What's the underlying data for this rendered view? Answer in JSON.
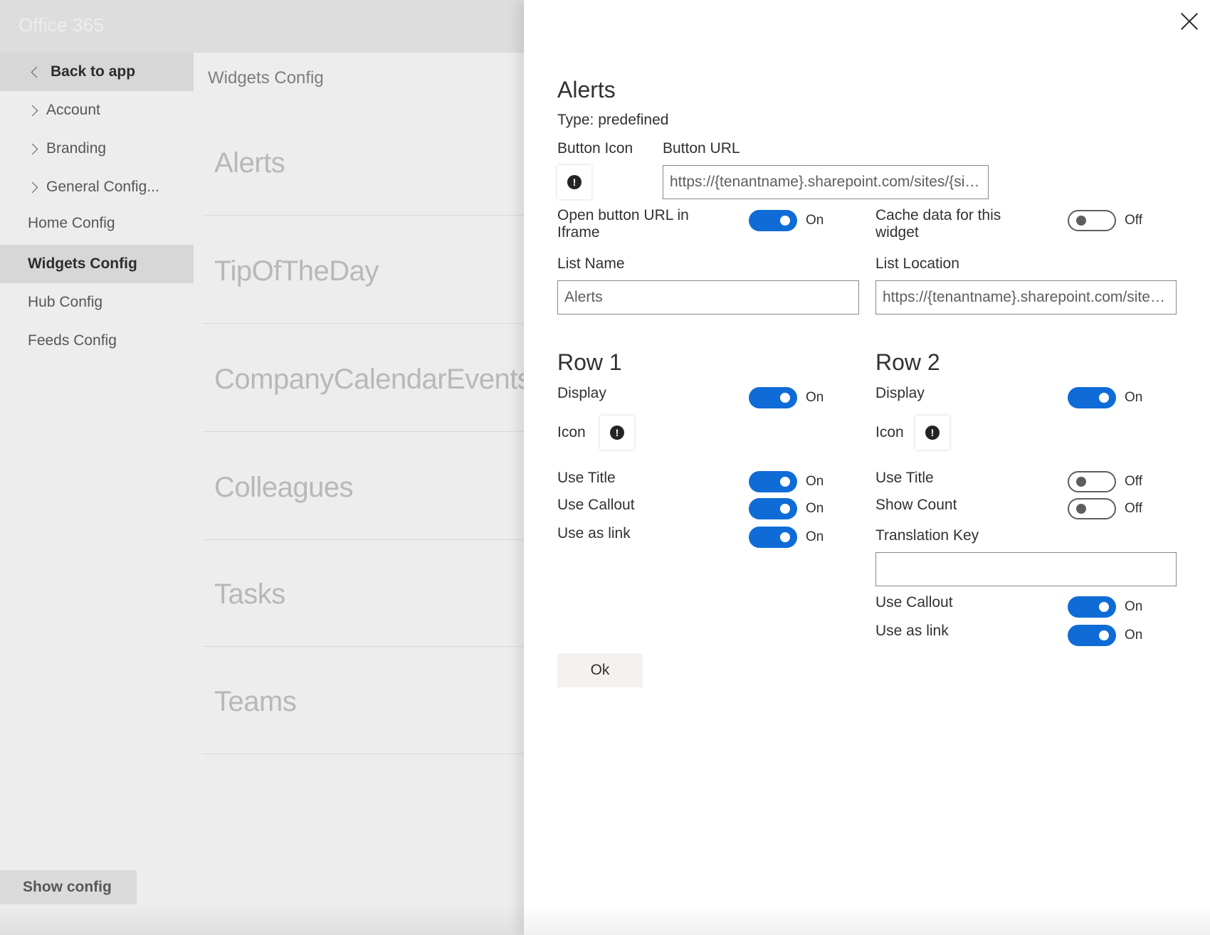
{
  "app": {
    "brand": "Office 365"
  },
  "nav": {
    "back_label": "Back to app",
    "items": [
      "Account",
      "Branding",
      "General Config...",
      "Home Config",
      "Widgets Config",
      "Hub Config",
      "Feeds Config"
    ],
    "selected": "Widgets Config",
    "show_config": "Show config"
  },
  "list": {
    "header": "Widgets Config",
    "widgets": [
      "Alerts",
      "TipOfTheDay",
      "CompanyCalendarEvents",
      "Colleagues",
      "Tasks",
      "Teams"
    ]
  },
  "panel": {
    "title": "Alerts",
    "type_text": "Type: predefined",
    "button_icon_label": "Button Icon",
    "button_url_label": "Button URL",
    "button_url_value": "https://{tenantname}.sharepoint.com/sites/{sitename}/Lists/Alerts",
    "open_in_iframe_label": "Open button URL in Iframe",
    "open_in_iframe_state": "On",
    "cache_label": "Cache data for this widget",
    "cache_state": "Off",
    "list_name_label": "List Name",
    "list_name_value": "Alerts",
    "list_location_label": "List Location",
    "list_location_value": "https://{tenantname}.sharepoint.com/sites/{sitename}/Lists/Alerts",
    "row1": {
      "title": "Row 1",
      "display_label": "Display",
      "display_state": "On",
      "icon_label": "Icon",
      "use_title_label": "Use Title",
      "use_title_state": "On",
      "use_callout_label": "Use Callout",
      "use_callout_state": "On",
      "use_as_link_label": "Use as link",
      "use_as_link_state": "On"
    },
    "row2": {
      "title": "Row 2",
      "display_label": "Display",
      "display_state": "On",
      "icon_label": "Icon",
      "use_title_label": "Use Title",
      "use_title_state": "Off",
      "show_count_label": "Show Count",
      "show_count_state": "Off",
      "translation_key_label": "Translation Key",
      "translation_key_value": "",
      "use_callout_label": "Use Callout",
      "use_callout_state": "On",
      "use_as_link_label": "Use as link",
      "use_as_link_state": "On"
    },
    "ok_label": "Ok",
    "info_glyph": "!"
  },
  "colors": {
    "accent": "#0f6cd6",
    "nav_selected": "#e8e8e8"
  },
  "icons": {
    "close": "close-icon",
    "info": "info-icon",
    "back": "chevron-left-icon",
    "expand": "chevron-right-icon"
  }
}
